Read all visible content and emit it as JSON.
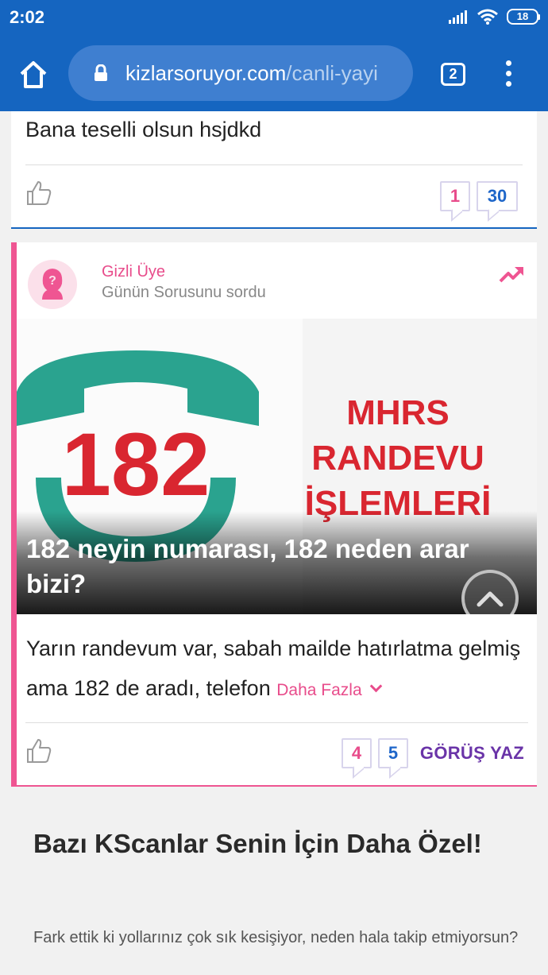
{
  "status_bar": {
    "time": "2:02",
    "battery": "18"
  },
  "browser": {
    "url_domain": "kizlarsoruyor.com",
    "url_path": "/canli-yayi",
    "tab_count": "2"
  },
  "card1": {
    "text": "Bana teselli olsun hsjdkd",
    "counts": {
      "pink": "1",
      "blue": "30"
    }
  },
  "card2": {
    "user": "Gizli Üye",
    "action": "Günün Sorusunu sordu",
    "image": {
      "number": "182",
      "lines": [
        "MHRS",
        "RANDEVU",
        "İŞLEMLERİ"
      ]
    },
    "title": "182 neyin numarası, 182 neden arar bizi?",
    "description": "Yarın randevum var, sabah mailde hatırlatma gelmiş ama 182 de aradı, telefon",
    "more_label": "Daha Fazla",
    "counts": {
      "pink": "4",
      "blue": "5"
    },
    "write_label": "GÖRÜŞ YAZ"
  },
  "section": {
    "title": "Bazı KScanlar Senin İçin Daha Özel!",
    "text": "Fark ettik ki yollarınız çok sık kesişiyor, neden hala takip etmiyorsun?"
  },
  "colors": {
    "brand_blue": "#1565c0",
    "pink": "#e84c8b",
    "purple": "#6a34a8",
    "teal": "#2aa38f",
    "red": "#d92630"
  }
}
